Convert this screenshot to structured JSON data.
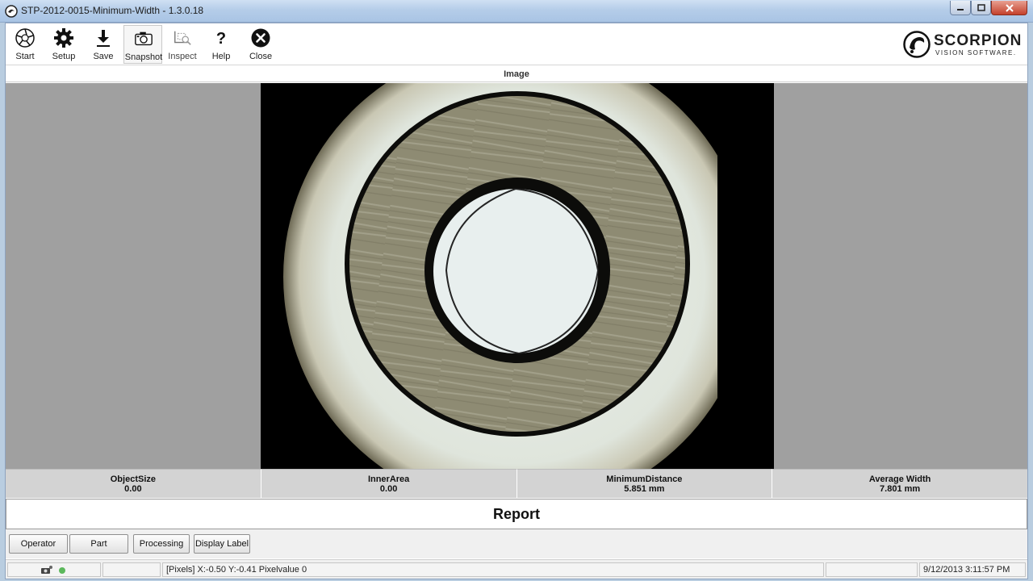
{
  "window": {
    "title": "STP-2012-0015-Minimum-Width - 1.3.0.18",
    "controls": {
      "minimize": "minimize",
      "maximize": "maximize",
      "close": "close"
    }
  },
  "toolbar": {
    "items": [
      {
        "label": "Start",
        "icon": "aperture-icon"
      },
      {
        "label": "Setup",
        "icon": "gear-icon"
      },
      {
        "label": "Save",
        "icon": "download-icon"
      },
      {
        "label": "Snapshot",
        "icon": "camera-icon",
        "selected": true
      },
      {
        "label": "Inspect",
        "icon": "inspect-icon",
        "disabled": true
      },
      {
        "label": "Help",
        "icon": "question-icon"
      },
      {
        "label": "Close",
        "icon": "close-circle-icon"
      }
    ]
  },
  "logo": {
    "brand": "SCORPION",
    "sub": "VISION SOFTWARE."
  },
  "image_panel": {
    "title": "Image"
  },
  "results": [
    {
      "name": "ObjectSize",
      "value": "0.00"
    },
    {
      "name": "InnerArea",
      "value": "0.00"
    },
    {
      "name": "MinimumDistance",
      "value": "5.851 mm"
    },
    {
      "name": "Average Width",
      "value": "7.801 mm"
    }
  ],
  "report": {
    "title": "Report"
  },
  "bottom_buttons": [
    "Operator",
    "Part",
    "Processing",
    "Display Label"
  ],
  "status": {
    "coords": "[Pixels] X:-0.50 Y:-0.41  Pixelvalue 0",
    "datetime": "9/12/2013 3:11:57 PM",
    "indicator_color": "#5cb85c"
  },
  "colors": {
    "ring_metal": "#8f8c74",
    "background_disc": "#e2e8df",
    "hole": "#e8efee"
  }
}
